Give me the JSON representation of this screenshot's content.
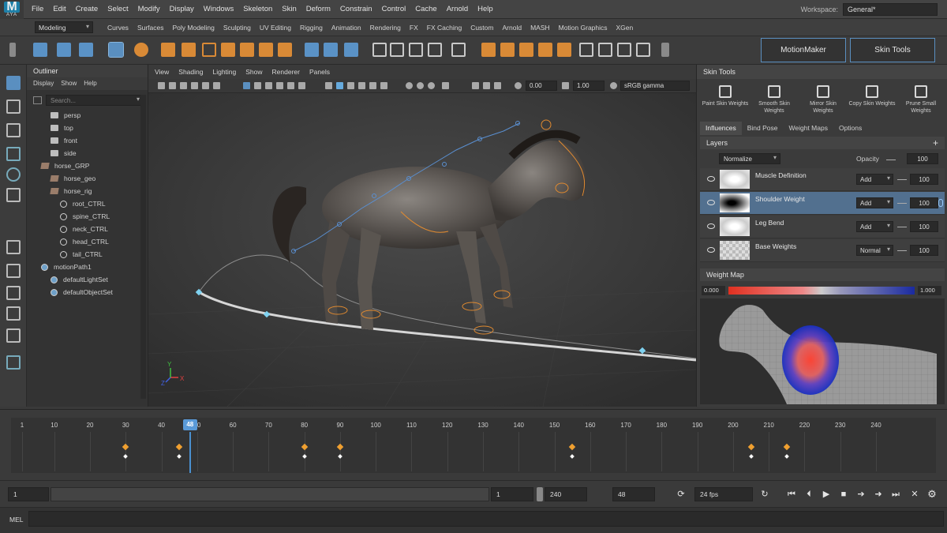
{
  "app": {
    "logo_letter": "M",
    "logo_sub": "AYA"
  },
  "menu": [
    "File",
    "Edit",
    "Create",
    "Select",
    "Modify",
    "Display",
    "Windows",
    "Skeleton",
    "Skin",
    "Deform",
    "Constrain",
    "Control",
    "Cache",
    "Arnold",
    "Help"
  ],
  "workspace": {
    "label": "Workspace:",
    "value": "General*"
  },
  "shelf": {
    "mode": "Modeling",
    "tabs": [
      "Curves",
      "Surfaces",
      "Poly Modeling",
      "Sculpting",
      "UV Editing",
      "Rigging",
      "Animation",
      "Rendering",
      "FX",
      "FX Caching",
      "Custom",
      "Arnold",
      "MASH",
      "Motion Graphics",
      "XGen"
    ]
  },
  "toolbar": {
    "motionmaker_label": "MotionMaker",
    "skintools_label": "Skin Tools"
  },
  "outliner": {
    "title": "Outliner",
    "menu": [
      "Display",
      "Show",
      "Help"
    ],
    "search_placeholder": "Search...",
    "items": [
      {
        "label": "persp",
        "icon": "camera-icon"
      },
      {
        "label": "top",
        "icon": "camera-icon"
      },
      {
        "label": "front",
        "icon": "camera-icon"
      },
      {
        "label": "side",
        "icon": "camera-icon"
      },
      {
        "label": "horse_GRP",
        "icon": "group-icon"
      },
      {
        "label": "horse_geo",
        "icon": "mesh-icon"
      },
      {
        "label": "horse_rig",
        "icon": "joint-icon"
      },
      {
        "label": "root_CTRL",
        "icon": "control-icon"
      },
      {
        "label": "spine_CTRL",
        "icon": "control-icon"
      },
      {
        "label": "neck_CTRL",
        "icon": "control-icon"
      },
      {
        "label": "head_CTRL",
        "icon": "control-icon"
      },
      {
        "label": "tail_CTRL",
        "icon": "control-icon"
      },
      {
        "label": "motionPath1",
        "icon": "motionpath-icon"
      },
      {
        "label": "defaultLightSet",
        "icon": "set-icon"
      },
      {
        "label": "defaultObjectSet",
        "icon": "set-icon"
      }
    ]
  },
  "viewport": {
    "menu": [
      "View",
      "Shading",
      "Lighting",
      "Show",
      "Renderer",
      "Panels"
    ],
    "field_a": "0.00",
    "field_b": "1.00",
    "color_space": "sRGB gamma",
    "axis_x": "X",
    "axis_y": "Y",
    "axis_z": "Z"
  },
  "skin_tools": {
    "title": "Skin Tools",
    "tools": [
      {
        "label": "Paint Skin Weights",
        "icon": "brush-icon"
      },
      {
        "label": "Smooth Skin Weights",
        "icon": "smooth-icon"
      },
      {
        "label": "Mirror Skin Weights",
        "icon": "mirror-icon"
      },
      {
        "label": "Copy Skin Weights",
        "icon": "copy-icon"
      },
      {
        "label": "Prune Small Weights",
        "icon": "prune-icon"
      }
    ],
    "tabs": [
      "Influences",
      "Bind Pose",
      "Weight Maps",
      "Options"
    ],
    "layers_title": "Layers",
    "normalize": "Normalize",
    "opacity_label": "Opacity",
    "opacity_value": "100",
    "layers": [
      {
        "name": "Muscle Definition",
        "mode": "Add",
        "value": "100"
      },
      {
        "name": "Shoulder Weight",
        "mode": "Add",
        "value": "100"
      },
      {
        "name": "Leg Bend",
        "mode": "Add",
        "value": "100"
      },
      {
        "name": "Base Weights",
        "mode": "Normal",
        "value": "100"
      }
    ],
    "weight_map_title": "Weight Map",
    "weight_min": "0.000",
    "weight_max": "1.000"
  },
  "timeline": {
    "ticks": [
      "1",
      "10",
      "20",
      "30",
      "40",
      "50",
      "60",
      "70",
      "80",
      "90",
      "100",
      "110",
      "120",
      "130",
      "140",
      "150",
      "160",
      "170",
      "180",
      "190",
      "200",
      "210",
      "220",
      "230",
      "240"
    ],
    "current_frame": "48",
    "keyframes_orange": [
      30,
      45,
      80,
      90,
      155,
      205,
      215
    ],
    "keyframes_white": [
      30,
      45,
      80,
      90,
      155,
      205,
      215
    ]
  },
  "range": {
    "start": "1",
    "range_start": "1",
    "range_end": "240",
    "current": "48",
    "fps": "24 fps"
  },
  "mel": {
    "label": "MEL"
  }
}
